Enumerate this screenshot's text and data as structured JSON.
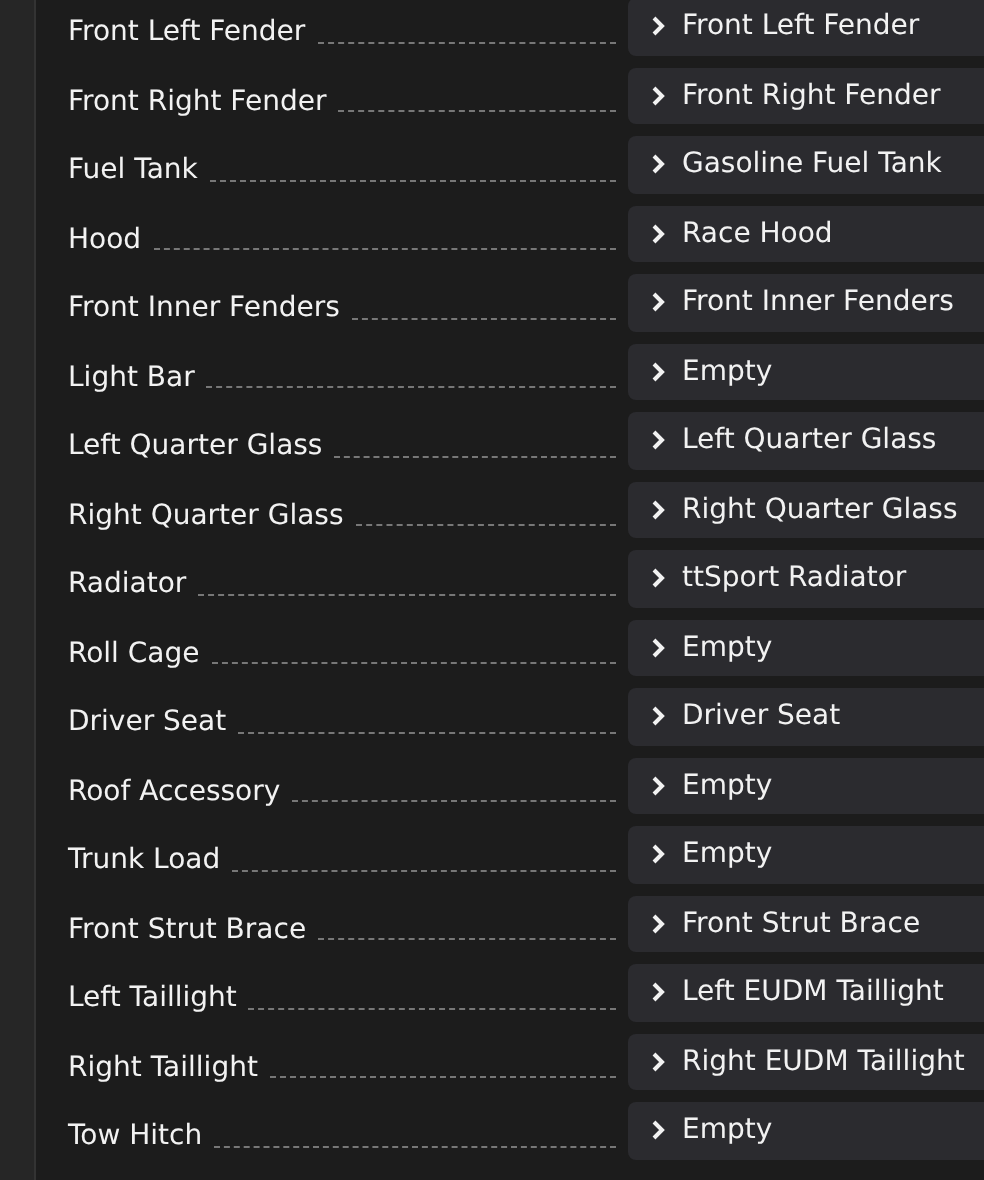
{
  "slots": [
    {
      "label": "Front Left Fender",
      "part": "Front Left Fender"
    },
    {
      "label": "Front Right Fender",
      "part": "Front Right Fender"
    },
    {
      "label": "Fuel Tank",
      "part": "Gasoline Fuel Tank"
    },
    {
      "label": "Hood",
      "part": "Race Hood"
    },
    {
      "label": "Front Inner Fenders",
      "part": "Front Inner Fenders"
    },
    {
      "label": "Light Bar",
      "part": "Empty"
    },
    {
      "label": "Left Quarter Glass",
      "part": "Left Quarter Glass"
    },
    {
      "label": "Right Quarter Glass",
      "part": "Right Quarter Glass"
    },
    {
      "label": "Radiator",
      "part": "ttSport Radiator"
    },
    {
      "label": "Roll Cage",
      "part": "Empty"
    },
    {
      "label": "Driver Seat",
      "part": "Driver Seat"
    },
    {
      "label": "Roof Accessory",
      "part": "Empty"
    },
    {
      "label": "Trunk Load",
      "part": "Empty"
    },
    {
      "label": "Front Strut Brace",
      "part": "Front Strut Brace"
    },
    {
      "label": "Left Taillight",
      "part": "Left EUDM Taillight"
    },
    {
      "label": "Right Taillight",
      "part": "Right EUDM Taillight"
    },
    {
      "label": "Tow Hitch",
      "part": "Empty"
    }
  ]
}
